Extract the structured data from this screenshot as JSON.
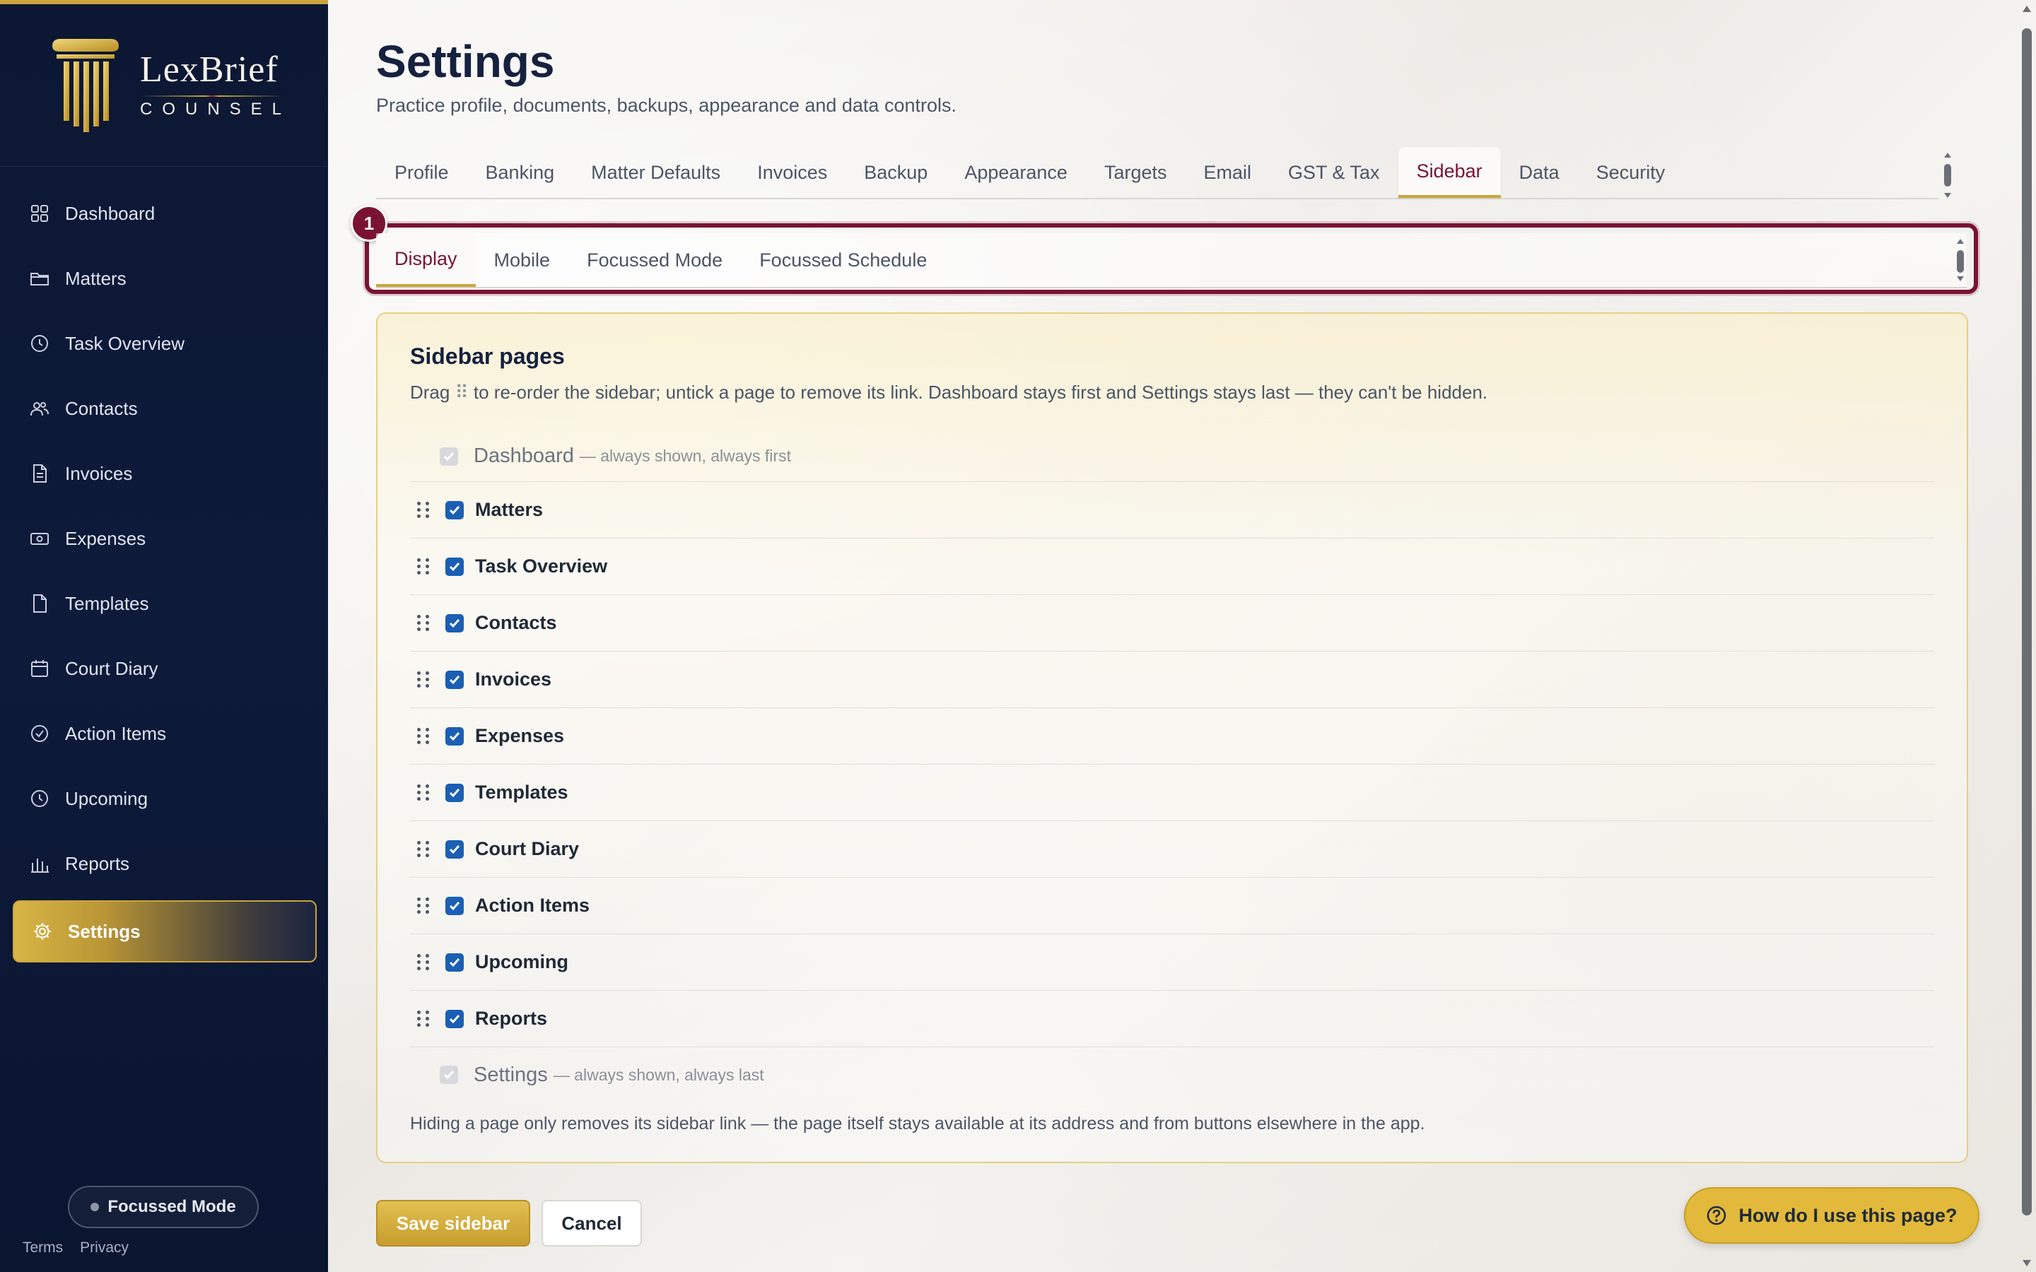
{
  "brand": {
    "name": "LexBrief",
    "sub": "COUNSEL"
  },
  "sidebar": {
    "items": [
      {
        "label": "Dashboard",
        "icon": "grid-icon"
      },
      {
        "label": "Matters",
        "icon": "folder-icon"
      },
      {
        "label": "Task Overview",
        "icon": "clock-icon"
      },
      {
        "label": "Contacts",
        "icon": "users-icon"
      },
      {
        "label": "Invoices",
        "icon": "document-icon"
      },
      {
        "label": "Expenses",
        "icon": "banknote-icon"
      },
      {
        "label": "Templates",
        "icon": "file-icon"
      },
      {
        "label": "Court Diary",
        "icon": "calendar-icon"
      },
      {
        "label": "Action Items",
        "icon": "check-circle-icon"
      },
      {
        "label": "Upcoming",
        "icon": "clock-icon"
      },
      {
        "label": "Reports",
        "icon": "bar-chart-icon"
      },
      {
        "label": "Settings",
        "icon": "gear-icon",
        "active": true
      }
    ],
    "focussed_mode": "Focussed Mode",
    "terms": "Terms",
    "privacy": "Privacy"
  },
  "page": {
    "title": "Settings",
    "subtitle": "Practice profile, documents, backups, appearance and data controls."
  },
  "tabs": [
    "Profile",
    "Banking",
    "Matter Defaults",
    "Invoices",
    "Backup",
    "Appearance",
    "Targets",
    "Email",
    "GST & Tax",
    "Sidebar",
    "Data",
    "Security"
  ],
  "active_tab": "Sidebar",
  "subtabs": [
    "Display",
    "Mobile",
    "Focussed Mode",
    "Focussed Schedule"
  ],
  "active_subtab": "Display",
  "badge": "1",
  "card": {
    "title": "Sidebar pages",
    "desc_before": "Drag",
    "desc_after": "to re-order the sidebar; untick a page to remove its link. Dashboard stays first and Settings stays last — they can't be hidden.",
    "first": {
      "label": "Dashboard",
      "note": "— always shown, always first"
    },
    "pages": [
      "Matters",
      "Task Overview",
      "Contacts",
      "Invoices",
      "Expenses",
      "Templates",
      "Court Diary",
      "Action Items",
      "Upcoming",
      "Reports"
    ],
    "last": {
      "label": "Settings",
      "note": "— always shown, always last"
    },
    "footer": "Hiding a page only removes its sidebar link — the page itself stays available at its address and from buttons elsewhere in the app."
  },
  "buttons": {
    "save": "Save sidebar",
    "cancel": "Cancel",
    "help": "How do I use this page?"
  },
  "colors": {
    "navy": "#0c1733",
    "gold": "#c9a53a",
    "maroon": "#7a1332",
    "checkbox": "#1a5fb4"
  }
}
